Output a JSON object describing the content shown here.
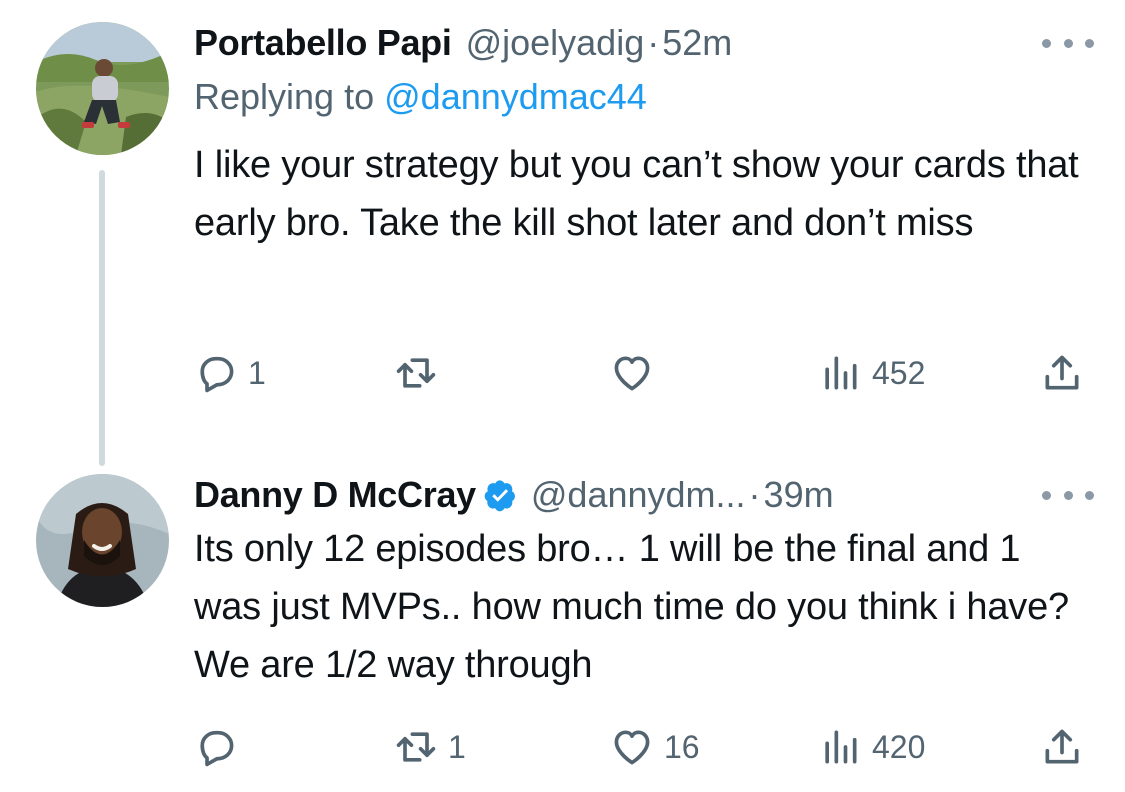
{
  "colors": {
    "text": "#0f1419",
    "secondary": "#536471",
    "link": "#1d9bf0",
    "thread_line": "#cfd9de",
    "verified": "#1d9bf0"
  },
  "tweets": [
    {
      "author_name": "Portabello Papi",
      "handle": "@joelyadig",
      "separator": "·",
      "time": "52m",
      "replying_prefix": "Replying to",
      "replying_to": "@dannydmac44",
      "verified": false,
      "text": "I like your strategy but you can’t show your cards that early bro. Take the kill shot later and don’t miss",
      "reply_count": "1",
      "retweet_count": "",
      "like_count": "",
      "view_count": "452",
      "icons": [
        "more-icon",
        "reply-icon",
        "retweet-icon",
        "like-icon",
        "views-icon",
        "share-icon"
      ]
    },
    {
      "author_name": "Danny D McCray",
      "handle": "@dannydm...",
      "separator": "·",
      "time": "39m",
      "verified": true,
      "text": "Its only 12 episodes bro… 1 will be the final and 1 was just MVPs.. how much time do you think i have? We are 1/2 way through",
      "reply_count": "",
      "retweet_count": "1",
      "like_count": "16",
      "view_count": "420",
      "icons": [
        "verified-badge-icon",
        "more-icon",
        "reply-icon",
        "retweet-icon",
        "like-icon",
        "views-icon",
        "share-icon"
      ]
    }
  ]
}
